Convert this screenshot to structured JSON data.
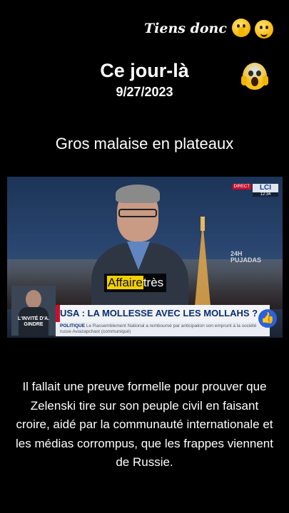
{
  "header": {
    "tiens_label": "Tiens donc",
    "title": "Ce jour-là",
    "date": "9/27/2023",
    "subtitle": "Gros malaise en plateaux"
  },
  "icons": [
    "shushing-face-icon",
    "grinning-face-icon",
    "screaming-face-icon",
    "like-thumb-icon"
  ],
  "video": {
    "channel": "LCI",
    "live_label": "DIRECT",
    "clock": "12:34",
    "program_tag_line1": "24H",
    "program_tag_line2": "PUJADAS",
    "inset_label": "L'INVITÉ D'A. GINDRE",
    "banner": "USA : LA MOLLESSE AVEC LES MOLLAHS ?",
    "ticker_label": "POLITIQUE",
    "ticker_text": "Le Rassemblement National a remboursé par anticipation son emprunt à la société russe Aviazapchast (communiqué)",
    "caption_highlight": "Affaire",
    "caption_rest": "très"
  },
  "body": {
    "text": "Il fallait une preuve formelle pour prouver que Zelenski tire sur son peuple civil en faisant croire, aidé par la communauté internationale et les médias corrompus, que les frappes viennent de Russie."
  },
  "colors": {
    "background": "#000000",
    "caption_highlight": "#f5d000",
    "banner_text": "#0a2d6e",
    "lci_red": "#c8102e"
  }
}
